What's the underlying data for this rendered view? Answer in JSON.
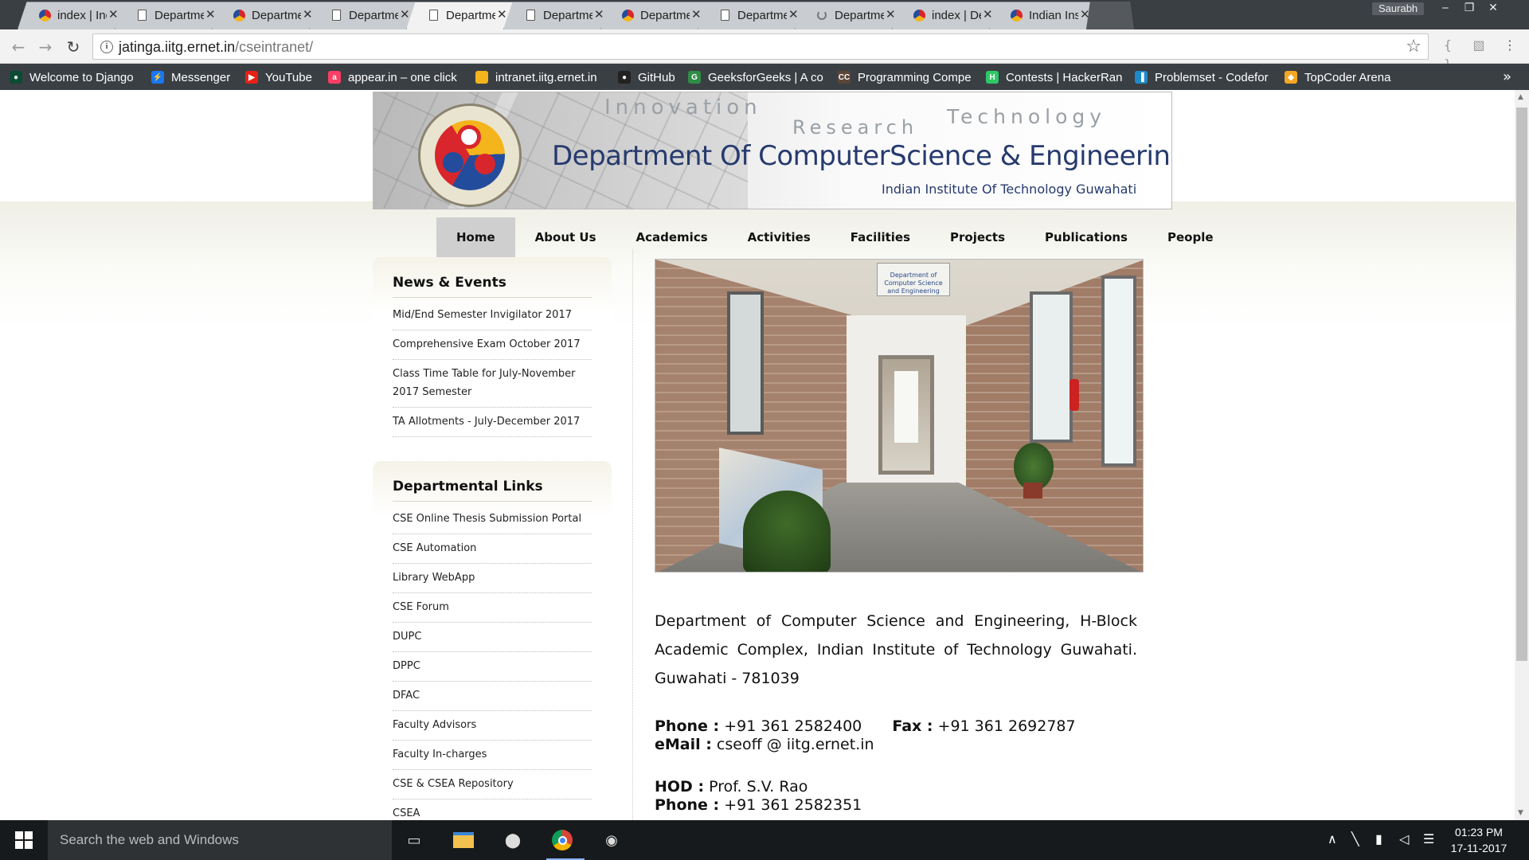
{
  "browser": {
    "tabs": [
      {
        "label": "index | Indi",
        "favicon": "iitg-logo-icon"
      },
      {
        "label": "Departmen",
        "favicon": "document-icon"
      },
      {
        "label": "Departmen",
        "favicon": "iitg-logo-icon"
      },
      {
        "label": "Departmen",
        "favicon": "document-icon"
      },
      {
        "label": "Departmen",
        "favicon": "document-icon",
        "active": true
      },
      {
        "label": "Departmen",
        "favicon": "document-icon"
      },
      {
        "label": "Departmen",
        "favicon": "iitg-logo-icon"
      },
      {
        "label": "Departmen",
        "favicon": "document-icon"
      },
      {
        "label": "Departmen",
        "favicon": "loading-icon"
      },
      {
        "label": "index | Dep",
        "favicon": "iitg-logo-icon"
      },
      {
        "label": "Indian Inst",
        "favicon": "iitg-logo-icon"
      }
    ],
    "tab_close": "✕",
    "profile_name": "Saurabh",
    "url_host": "jatinga.iitg.ernet.in",
    "url_path": "/cseintranet/",
    "bookmarks": [
      {
        "label": "Welcome to Django",
        "icon": "django-icon",
        "color": "#0c4b33"
      },
      {
        "label": "Messenger",
        "icon": "messenger-icon",
        "color": "#1877f2"
      },
      {
        "label": "YouTube",
        "icon": "youtube-icon",
        "color": "#e62117"
      },
      {
        "label": "appear.in – one click",
        "icon": "appear-in-icon",
        "color": "#fb3e63"
      },
      {
        "label": "intranet.iitg.ernet.in",
        "icon": "iitg-logo-icon",
        "color": "#f3b51b"
      },
      {
        "label": "GitHub",
        "icon": "github-icon",
        "color": "#222222"
      },
      {
        "label": "GeeksforGeeks | A co",
        "icon": "geeksforgeeks-icon",
        "color": "#2f8d46"
      },
      {
        "label": "Programming Compe",
        "icon": "codechef-icon",
        "color": "#5b4638"
      },
      {
        "label": "Contests | HackerRan",
        "icon": "hackerrank-icon",
        "color": "#2ec866"
      },
      {
        "label": "Problemset - Codefor",
        "icon": "codeforces-icon",
        "color": "#1f8acb"
      },
      {
        "label": "TopCoder Arena",
        "icon": "topcoder-icon",
        "color": "#f5a623"
      }
    ],
    "bookmarks_more": "»"
  },
  "site": {
    "banner": {
      "word_innovation": "Innovation",
      "word_research": "Research",
      "word_technology": "Technology",
      "title": "Department Of ComputerScience & Engineering",
      "subtitle": "Indian Institute Of Technology Guwahati"
    },
    "menu": [
      "Home",
      "About Us",
      "Academics",
      "Activities",
      "Facilities",
      "Projects",
      "Publications",
      "People"
    ],
    "news": {
      "heading": "News & Events",
      "items": [
        "Mid/End Semester Invigilator 2017",
        "Comprehensive Exam October 2017",
        "Class Time Table for July-November 2017 Semester",
        "TA Allotments - July-December 2017"
      ]
    },
    "links": {
      "heading": "Departmental Links",
      "items": [
        "CSE Online Thesis Submission Portal",
        "CSE Automation",
        "Library WebApp",
        "CSE Forum",
        "DUPC",
        "DPPC",
        "DFAC",
        "Faculty Advisors",
        "Faculty In-charges",
        "CSE & CSEA Repository",
        "CSEA"
      ]
    },
    "hero_sign": "Department of Computer Science and Engineering",
    "address": "Department of Computer Science and Engineering, H-Block Academic Complex, Indian Institute of Technology Guwahati. Guwahati - 781039",
    "phone_label": "Phone :",
    "phone_value": "+91 361 2582400",
    "fax_label": "Fax :",
    "fax_value": "+91 361 2692787",
    "email_label": "eMail :",
    "email_value": "cseoff @ iitg.ernet.in",
    "hod_label": "HOD :",
    "hod_value": "Prof. S.V. Rao",
    "hod_phone_label": "Phone :",
    "hod_phone_value": "+91 361 2582351"
  },
  "taskbar": {
    "search_placeholder": "Search the web and Windows",
    "time": "01:23 PM",
    "date": "17-11-2017"
  }
}
